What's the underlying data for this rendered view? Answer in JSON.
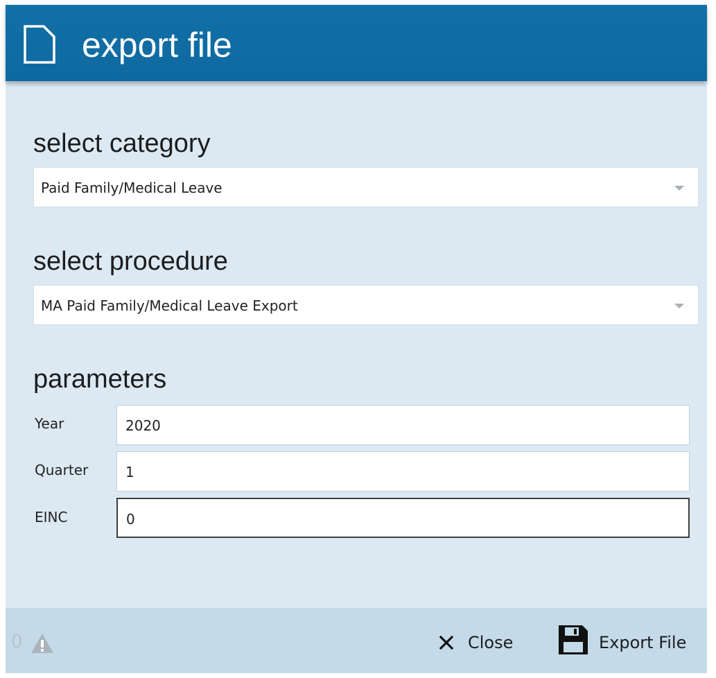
{
  "header": {
    "title": "export file",
    "icon": "file-icon"
  },
  "category": {
    "heading": "select category",
    "selected": "Paid Family/Medical Leave"
  },
  "procedure": {
    "heading": "select procedure",
    "selected": "MA Paid Family/Medical Leave Export"
  },
  "parameters": {
    "heading": "parameters",
    "fields": [
      {
        "label": "Year",
        "value": "2020"
      },
      {
        "label": "Quarter",
        "value": "1"
      },
      {
        "label": "EINC",
        "value": "0"
      }
    ]
  },
  "footer": {
    "warning_count": "0",
    "close_label": "Close",
    "export_label": "Export File"
  },
  "colors": {
    "header_bg": "#0e69a0",
    "dialog_bg": "#dce9f3",
    "footer_bg": "#c4dae9"
  }
}
